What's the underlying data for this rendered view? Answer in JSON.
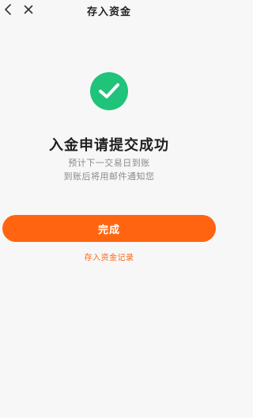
{
  "header": {
    "title": "存入资金",
    "back_icon": "chevron-left-icon",
    "close_icon": "close-icon"
  },
  "result": {
    "icon": "checkmark-circle-icon",
    "icon_color": "#1fc37a",
    "title": "入金申请提交成功",
    "desc_line1": "预计下一交易日到账",
    "desc_line2": "到账后将用邮件通知您"
  },
  "actions": {
    "done_label": "完成",
    "done_color": "#ff6510",
    "records_link": "存入资金记录"
  }
}
